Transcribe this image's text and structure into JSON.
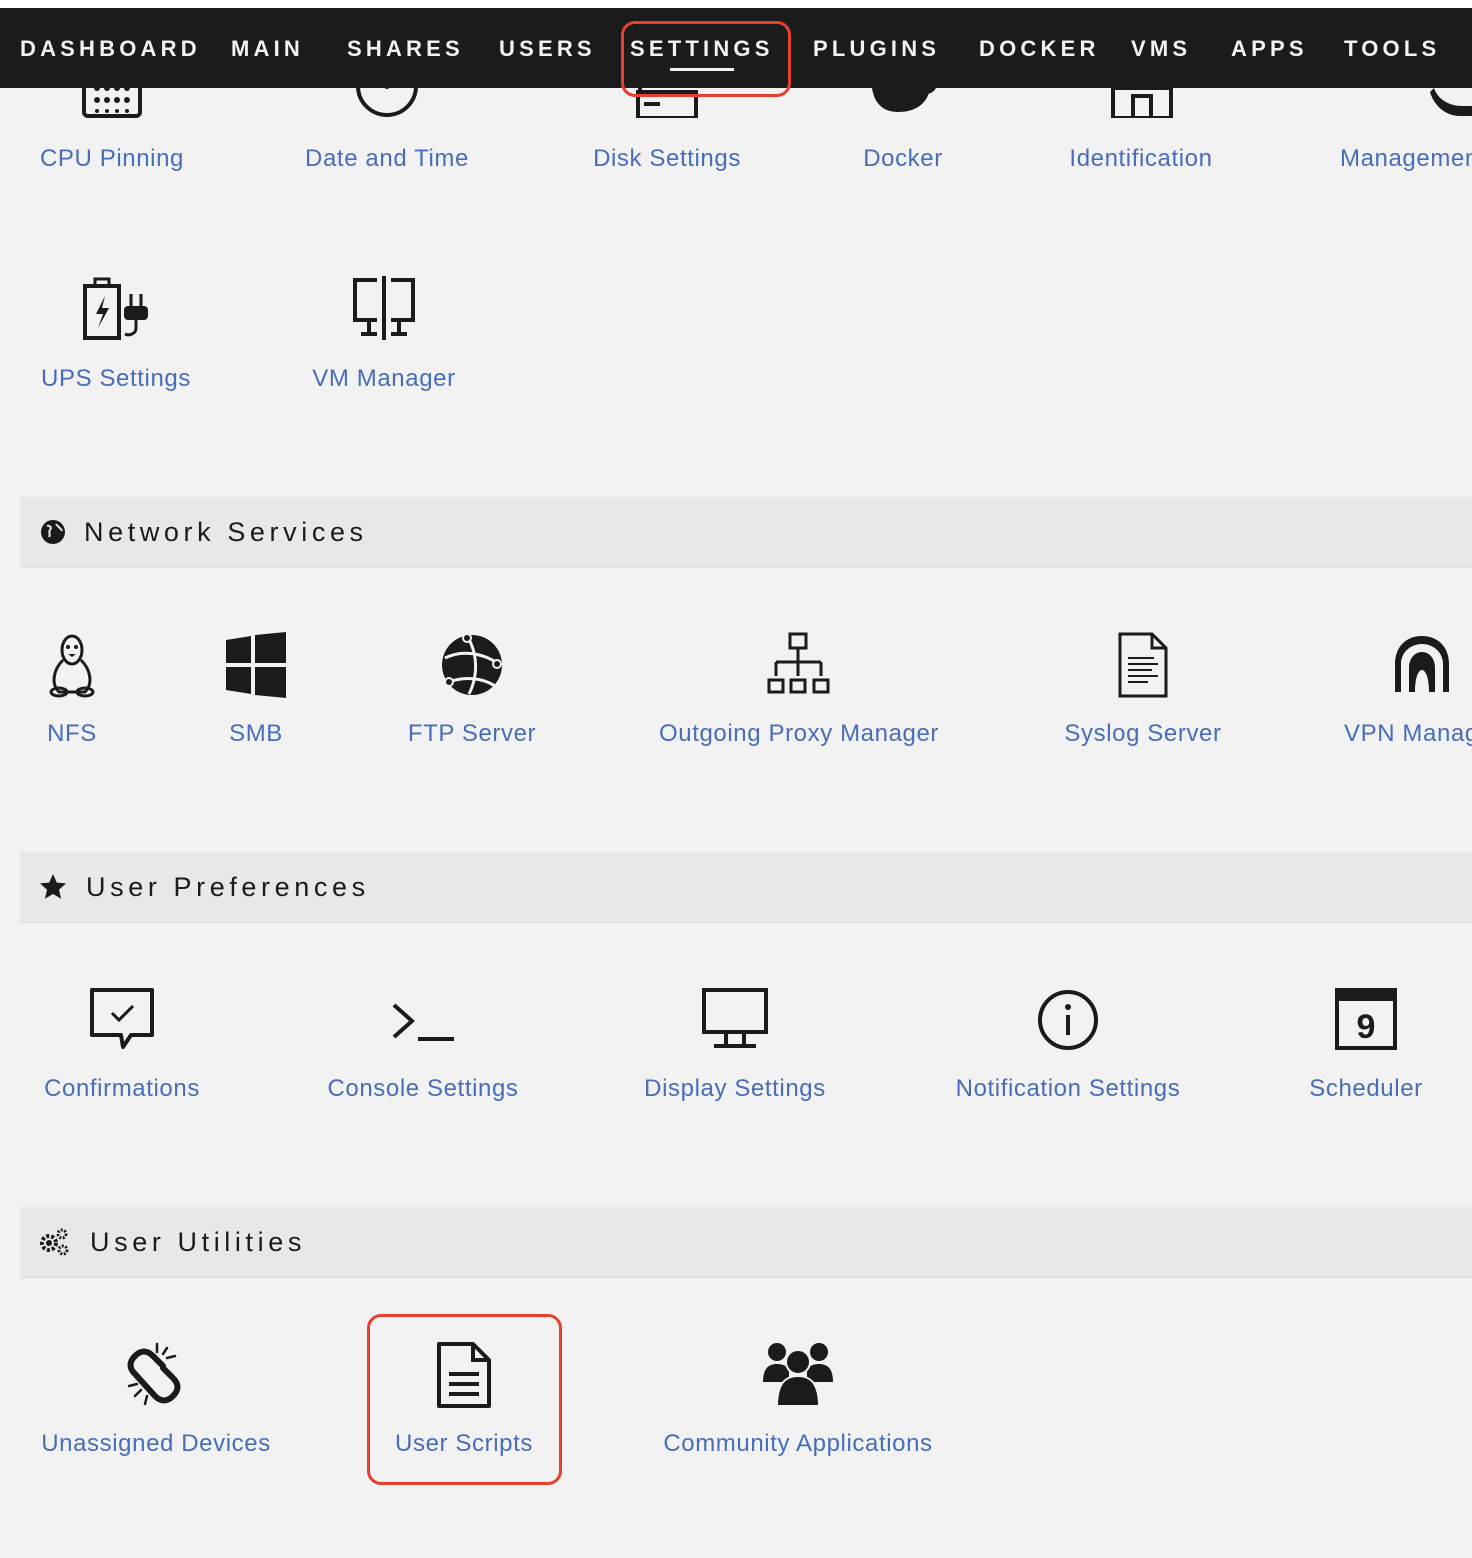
{
  "nav": {
    "items": [
      "DASHBOARD",
      "MAIN",
      "SHARES",
      "USERS",
      "SETTINGS",
      "PLUGINS",
      "DOCKER",
      "VMS",
      "APPS",
      "TOOLS"
    ],
    "active": "SETTINGS"
  },
  "system_settings": {
    "items": [
      "CPU Pinning",
      "Date and Time",
      "Disk Settings",
      "Docker",
      "Identification",
      "Managemen",
      "UPS Settings",
      "VM Manager"
    ]
  },
  "network_services": {
    "title": "Network Services",
    "items": [
      "NFS",
      "SMB",
      "FTP Server",
      "Outgoing Proxy Manager",
      "Syslog Server",
      "VPN Manag"
    ]
  },
  "user_preferences": {
    "title": "User Preferences",
    "items": [
      "Confirmations",
      "Console Settings",
      "Display Settings",
      "Notification Settings",
      "Scheduler"
    ]
  },
  "user_utilities": {
    "title": "User Utilities",
    "items": [
      "Unassigned Devices",
      "User Scripts",
      "Community Applications"
    ]
  },
  "icons": {
    "scheduler_day": "9"
  },
  "colors": {
    "nav_bg": "#1c1b1b",
    "link": "#486dba",
    "highlight": "#e8402e",
    "section_bg": "#e8e8e8",
    "page_bg": "#f2f2f2"
  }
}
